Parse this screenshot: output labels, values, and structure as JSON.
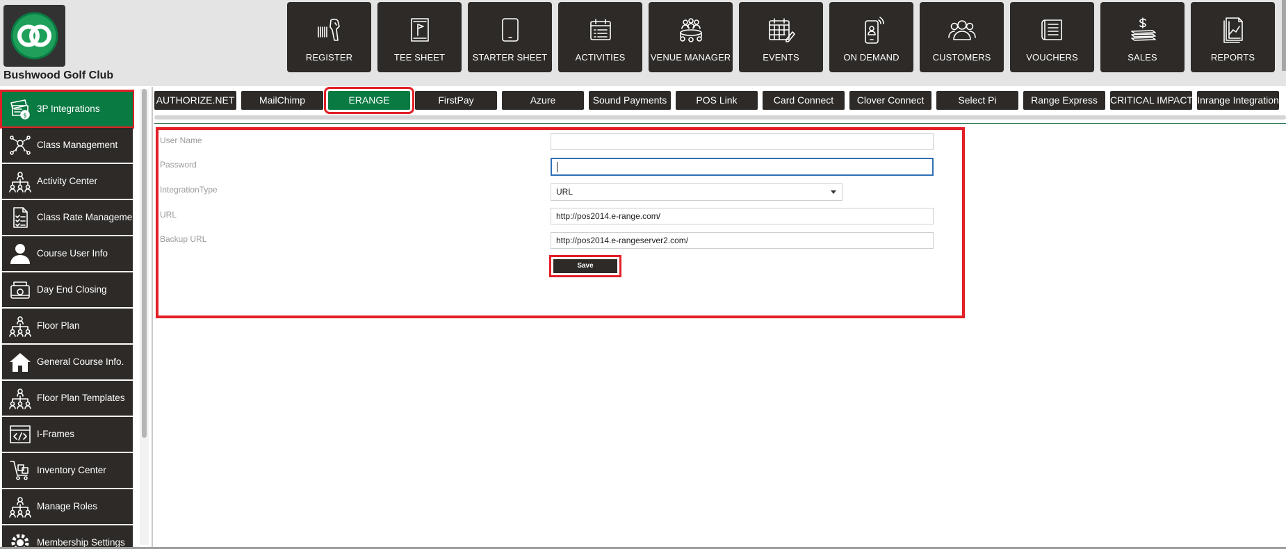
{
  "app": {
    "club_name": "Bushwood Golf Club",
    "brand_color": "#0a7a43",
    "dark_color": "#2d2a27",
    "highlight_color": "#e11f26"
  },
  "nav": [
    {
      "label": "REGISTER",
      "icon": "barcode-scanner-icon"
    },
    {
      "label": "TEE SHEET",
      "icon": "flag-sheet-icon"
    },
    {
      "label": "STARTER SHEET",
      "icon": "tablet-icon"
    },
    {
      "label": "ACTIVITIES",
      "icon": "calendar-list-icon"
    },
    {
      "label": "VENUE MANAGER",
      "icon": "meeting-table-icon"
    },
    {
      "label": "EVENTS",
      "icon": "calendar-edit-icon"
    },
    {
      "label": "ON DEMAND",
      "icon": "mobile-user-icon"
    },
    {
      "label": "CUSTOMERS",
      "icon": "group-icon"
    },
    {
      "label": "VOUCHERS",
      "icon": "voucher-icon"
    },
    {
      "label": "SALES",
      "icon": "money-stack-icon"
    },
    {
      "label": "REPORTS",
      "icon": "report-chart-icon"
    }
  ],
  "sidebar": [
    {
      "label": "3P Integrations",
      "icon": "integration-icon",
      "active": true
    },
    {
      "label": "Class Management",
      "icon": "class-network-icon"
    },
    {
      "label": "Activity  Center",
      "icon": "org-chart-icon"
    },
    {
      "label": "Class Rate Management",
      "icon": "checklist-doc-icon"
    },
    {
      "label": "Course User Info",
      "icon": "user-icon"
    },
    {
      "label": "Day End Closing",
      "icon": "register-close-icon"
    },
    {
      "label": "Floor Plan",
      "icon": "org-chart-icon"
    },
    {
      "label": "General Course Info.",
      "icon": "home-icon"
    },
    {
      "label": "Floor Plan Templates",
      "icon": "org-chart-icon"
    },
    {
      "label": "I-Frames",
      "icon": "code-frame-icon"
    },
    {
      "label": "Inventory Center",
      "icon": "inventory-cart-icon"
    },
    {
      "label": "Manage Roles",
      "icon": "org-chart-icon"
    },
    {
      "label": "Membership Settings",
      "icon": "settings-gear-icon"
    }
  ],
  "tabs": [
    {
      "label": "AUTHORIZE.NET"
    },
    {
      "label": "MailChimp"
    },
    {
      "label": "ERANGE",
      "active": true
    },
    {
      "label": "FirstPay"
    },
    {
      "label": "Azure"
    },
    {
      "label": "Sound Payments"
    },
    {
      "label": "POS Link"
    },
    {
      "label": "Card Connect"
    },
    {
      "label": "Clover Connect"
    },
    {
      "label": "Select Pi"
    },
    {
      "label": "Range Express"
    },
    {
      "label": "CRITICAL IMPACT"
    },
    {
      "label": "Inrange Integration"
    }
  ],
  "form": {
    "username_label": "User Name",
    "username_value": "",
    "password_label": "Password",
    "password_value": "",
    "integration_type_label": "IntegrationType",
    "integration_type_value": "URL",
    "url_label": "URL",
    "url_value": "http://pos2014.e-range.com/",
    "backup_url_label": "Backup URL",
    "backup_url_value": "http://pos2014.e-rangeserver2.com/",
    "save_label": "Save"
  }
}
